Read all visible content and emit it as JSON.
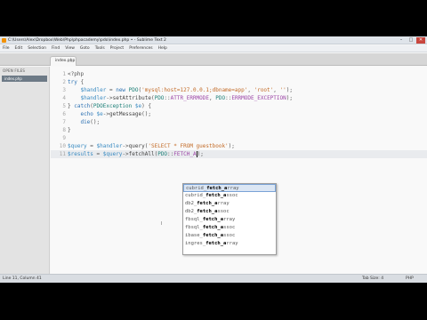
{
  "window": {
    "title": "C:\\Users\\Alex\\Dropbox\\Web\\Php\\phpacademy\\pdo\\index.php • - Sublime Text 2",
    "controls": [
      "–",
      "□",
      "✕"
    ]
  },
  "menu": [
    "File",
    "Edit",
    "Selection",
    "Find",
    "View",
    "Goto",
    "Tools",
    "Project",
    "Preferences",
    "Help"
  ],
  "sidebar": {
    "header": "OPEN FILES",
    "files": [
      "index.php"
    ]
  },
  "tab": {
    "label": "index.php",
    "close": "×"
  },
  "editor": {
    "lines": [
      {
        "n": "1",
        "parts": [
          [
            "p",
            "<?php"
          ]
        ]
      },
      {
        "n": "2",
        "parts": [
          [
            "k",
            "try"
          ],
          [
            "p",
            " {"
          ]
        ]
      },
      {
        "n": "3",
        "parts": [
          [
            "p",
            "    "
          ],
          [
            "v",
            "$handler"
          ],
          [
            "p",
            " = "
          ],
          [
            "k",
            "new"
          ],
          [
            "p",
            " "
          ],
          [
            "c",
            "PDO"
          ],
          [
            "p",
            "("
          ],
          [
            "s",
            "'mysql:host=127.0.0.1;dbname=app'"
          ],
          [
            "p",
            ", "
          ],
          [
            "s",
            "'root'"
          ],
          [
            "p",
            ", "
          ],
          [
            "s",
            "''"
          ],
          [
            "p",
            ");"
          ]
        ]
      },
      {
        "n": "4",
        "parts": [
          [
            "p",
            "    "
          ],
          [
            "v",
            "$handler"
          ],
          [
            "p",
            "->"
          ],
          [
            "fn",
            "setAttribute"
          ],
          [
            "p",
            "("
          ],
          [
            "c",
            "PDO"
          ],
          [
            "p",
            "::"
          ],
          [
            "d",
            "ATTR_ERRMODE"
          ],
          [
            "p",
            ", "
          ],
          [
            "c",
            "PDO"
          ],
          [
            "p",
            "::"
          ],
          [
            "d",
            "ERRMODE_EXCEPTION"
          ],
          [
            "p",
            ");"
          ]
        ]
      },
      {
        "n": "5",
        "parts": [
          [
            "p",
            "} "
          ],
          [
            "k",
            "catch"
          ],
          [
            "p",
            "("
          ],
          [
            "c",
            "PDOException"
          ],
          [
            "p",
            " "
          ],
          [
            "v",
            "$e"
          ],
          [
            "p",
            ") {"
          ]
        ]
      },
      {
        "n": "6",
        "parts": [
          [
            "p",
            "    "
          ],
          [
            "k",
            "echo"
          ],
          [
            "p",
            " "
          ],
          [
            "v",
            "$e"
          ],
          [
            "p",
            "->"
          ],
          [
            "fn",
            "getMessage"
          ],
          [
            "p",
            "();"
          ]
        ]
      },
      {
        "n": "7",
        "parts": [
          [
            "p",
            "    "
          ],
          [
            "k",
            "die"
          ],
          [
            "p",
            "();"
          ]
        ]
      },
      {
        "n": "8",
        "parts": [
          [
            "p",
            "}"
          ]
        ]
      },
      {
        "n": "9",
        "parts": []
      },
      {
        "n": "10",
        "parts": [
          [
            "v",
            "$query"
          ],
          [
            "p",
            " = "
          ],
          [
            "v",
            "$handler"
          ],
          [
            "p",
            "->"
          ],
          [
            "fn",
            "query"
          ],
          [
            "p",
            "("
          ],
          [
            "s",
            "'SELECT * FROM guestbook'"
          ],
          [
            "p",
            ");"
          ]
        ]
      },
      {
        "n": "11",
        "parts": [
          [
            "v",
            "$results"
          ],
          [
            "p",
            " = "
          ],
          [
            "v",
            "$query"
          ],
          [
            "p",
            "->"
          ],
          [
            "fn",
            "fetchAll"
          ],
          [
            "p",
            "("
          ],
          [
            "c",
            "PDO"
          ],
          [
            "p",
            "::"
          ],
          [
            "d",
            "FETCH_A"
          ],
          [
            "p",
            ");"
          ]
        ]
      }
    ],
    "current_line": 11
  },
  "autocomplete": [
    {
      "pre": "cubrid_",
      "bold": "fetch_a",
      "post": "rray",
      "selected": true
    },
    {
      "pre": "cubrid_",
      "bold": "fetch_a",
      "post": "ssoc",
      "selected": false
    },
    {
      "pre": "db2_",
      "bold": "fetch_a",
      "post": "rray",
      "selected": false
    },
    {
      "pre": "db2_",
      "bold": "fetch_a",
      "post": "ssoc",
      "selected": false
    },
    {
      "pre": "fbsql_",
      "bold": "fetch_a",
      "post": "rray",
      "selected": false
    },
    {
      "pre": "fbsql_",
      "bold": "fetch_a",
      "post": "ssoc",
      "selected": false
    },
    {
      "pre": "ibase_",
      "bold": "fetch_a",
      "post": "ssoc",
      "selected": false
    },
    {
      "pre": "ingres_",
      "bold": "fetch_a",
      "post": "rray",
      "selected": false
    }
  ],
  "status": {
    "position": "Line 11, Column 41",
    "tab_size": "Tab Size: 4",
    "syntax": "PHP"
  }
}
